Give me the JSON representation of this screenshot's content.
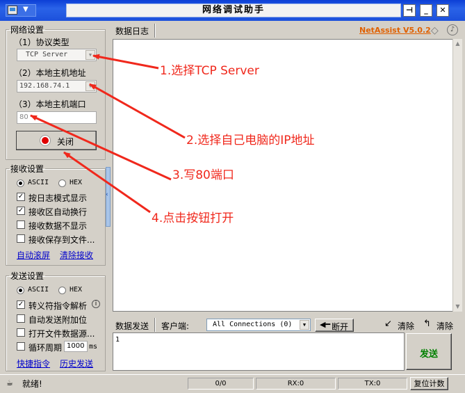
{
  "window": {
    "title": "网络调试助手"
  },
  "network": {
    "legend": "网络设置",
    "protocol_label": "（1）协议类型",
    "protocol_value": "TCP Server",
    "host_label": "（2）本地主机地址",
    "host_value": "192.168.74.1",
    "port_label": "（3）本地主机端口",
    "port_value": "80",
    "toggle_label": "关闭"
  },
  "receive": {
    "legend": "接收设置",
    "ascii": "ASCII",
    "hex": "HEX",
    "options": [
      "按日志模式显示",
      "接收区自动换行",
      "接收数据不显示",
      "接收保存到文件..."
    ],
    "checked": [
      true,
      true,
      false,
      false
    ],
    "auto_clear": "自动滚屏",
    "clear": "清除接收"
  },
  "send_settings": {
    "legend": "发送设置",
    "ascii": "ASCII",
    "hex": "HEX",
    "options": [
      "转义符指令解析",
      "自动发送附加位",
      "打开文件数据源...",
      "循环周期"
    ],
    "checked": [
      true,
      false,
      false,
      false
    ],
    "period_value": "1000",
    "period_unit": "ms",
    "quick_cmd": "快捷指令",
    "history": "历史发送"
  },
  "log": {
    "tab_label": "数据日志",
    "brand": "NetAssist V5.0.2"
  },
  "send": {
    "tab_label": "数据发送",
    "client_label": "客户端:",
    "client_value": "All Connections (0)",
    "disconnect": "断开",
    "clear1": "清除",
    "clear2": "清除",
    "input_value": "1",
    "send_button": "发送"
  },
  "status": {
    "ready": "就绪!",
    "count": "0/0",
    "rx": "RX:0",
    "tx": "TX:0",
    "reset": "复位计数"
  },
  "annotations": {
    "step1": "1.选择TCP Server",
    "step2": "2.选择自己电脑的IP地址",
    "step3": "3.写80端口",
    "step4": "4.点击按钮打开"
  },
  "colors": {
    "annotation_red": "#f0281c",
    "brand_orange": "#e06000",
    "send_green": "#008000",
    "link_blue": "#0000cc"
  }
}
